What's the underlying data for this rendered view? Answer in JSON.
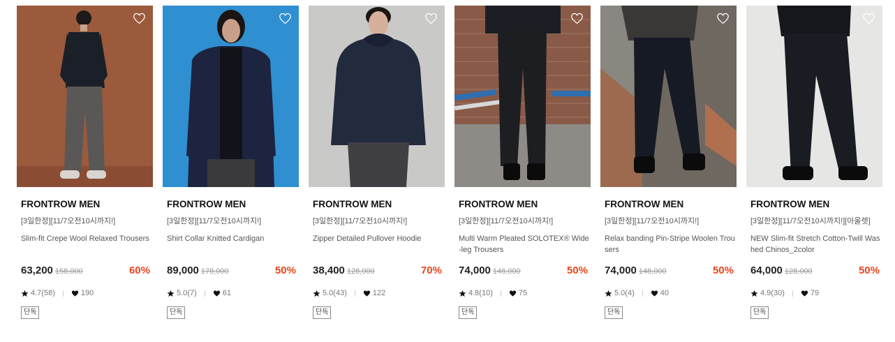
{
  "products": [
    {
      "brand": "FRONTROW MEN",
      "promo": "[3일한정][11/7오전10시까지!]",
      "name": "Slim-fit Crepe Wool Relaxed Trousers",
      "price": "63,200",
      "original_price": "158,000",
      "discount": "60%",
      "rating": "4.7(58)",
      "likes": "190",
      "tag": "단독",
      "background_color": "#9b5a3c"
    },
    {
      "brand": "FRONTROW MEN",
      "promo": "[3일한정][11/7오전10시까지!]",
      "name": "Shirt Collar Knitted Cardigan",
      "price": "89,000",
      "original_price": "178,000",
      "discount": "50%",
      "rating": "5.0(7)",
      "likes": "61",
      "tag": "단독",
      "background_color": "#2f8fd0"
    },
    {
      "brand": "FRONTROW MEN",
      "promo": "[3일한정][11/7오전10시까지!]",
      "name": "Zipper Detailed Pullover Hoodie",
      "price": "38,400",
      "original_price": "128,000",
      "discount": "70%",
      "rating": "5.0(43)",
      "likes": "122",
      "tag": "단독",
      "background_color": "#c9c9c7"
    },
    {
      "brand": "FRONTROW MEN",
      "promo": "[3일한정][11/7오전10시까지!]",
      "name": "Multi Warm Pleated SOLOTEX® Wide-leg Trousers",
      "price": "74,000",
      "original_price": "148,000",
      "discount": "50%",
      "rating": "4.8(10)",
      "likes": "75",
      "tag": "단독",
      "background_color": "#8a5a48"
    },
    {
      "brand": "FRONTROW MEN",
      "promo": "[3일한정][11/7오전10시까지!]",
      "name": "Relax banding Pin-Stripe Woolen Trousers",
      "price": "74,000",
      "original_price": "148,000",
      "discount": "50%",
      "rating": "5.0(4)",
      "likes": "40",
      "tag": "단독",
      "background_color": "#6e6860"
    },
    {
      "brand": "FRONTROW MEN",
      "promo": "[3일한정][11/7오전10시까지!][아울렛]",
      "name": "NEW Slim-fit Stretch Cotton-Twill Washed Chinos_2color",
      "price": "64,000",
      "original_price": "128,000",
      "discount": "50%",
      "rating": "4.9(30)",
      "likes": "79",
      "tag": "단독",
      "background_color": "#e6e6e4"
    }
  ],
  "colors": {
    "discount": "#e8461e",
    "text": "#222222",
    "muted": "#777777"
  },
  "icons": {
    "wishlist": "heart-outline-icon",
    "rating": "star-icon",
    "likes": "heart-filled-icon"
  }
}
